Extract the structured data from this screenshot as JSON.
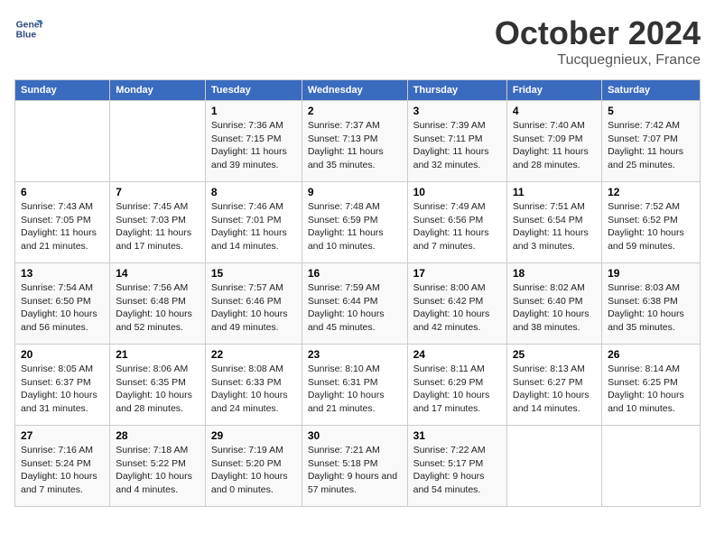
{
  "header": {
    "logo_line1": "General",
    "logo_line2": "Blue",
    "month_year": "October 2024",
    "location": "Tucquegnieux, France"
  },
  "days_of_week": [
    "Sunday",
    "Monday",
    "Tuesday",
    "Wednesday",
    "Thursday",
    "Friday",
    "Saturday"
  ],
  "weeks": [
    [
      {
        "day": "",
        "info": ""
      },
      {
        "day": "",
        "info": ""
      },
      {
        "day": "1",
        "info": "Sunrise: 7:36 AM\nSunset: 7:15 PM\nDaylight: 11 hours and 39 minutes."
      },
      {
        "day": "2",
        "info": "Sunrise: 7:37 AM\nSunset: 7:13 PM\nDaylight: 11 hours and 35 minutes."
      },
      {
        "day": "3",
        "info": "Sunrise: 7:39 AM\nSunset: 7:11 PM\nDaylight: 11 hours and 32 minutes."
      },
      {
        "day": "4",
        "info": "Sunrise: 7:40 AM\nSunset: 7:09 PM\nDaylight: 11 hours and 28 minutes."
      },
      {
        "day": "5",
        "info": "Sunrise: 7:42 AM\nSunset: 7:07 PM\nDaylight: 11 hours and 25 minutes."
      }
    ],
    [
      {
        "day": "6",
        "info": "Sunrise: 7:43 AM\nSunset: 7:05 PM\nDaylight: 11 hours and 21 minutes."
      },
      {
        "day": "7",
        "info": "Sunrise: 7:45 AM\nSunset: 7:03 PM\nDaylight: 11 hours and 17 minutes."
      },
      {
        "day": "8",
        "info": "Sunrise: 7:46 AM\nSunset: 7:01 PM\nDaylight: 11 hours and 14 minutes."
      },
      {
        "day": "9",
        "info": "Sunrise: 7:48 AM\nSunset: 6:59 PM\nDaylight: 11 hours and 10 minutes."
      },
      {
        "day": "10",
        "info": "Sunrise: 7:49 AM\nSunset: 6:56 PM\nDaylight: 11 hours and 7 minutes."
      },
      {
        "day": "11",
        "info": "Sunrise: 7:51 AM\nSunset: 6:54 PM\nDaylight: 11 hours and 3 minutes."
      },
      {
        "day": "12",
        "info": "Sunrise: 7:52 AM\nSunset: 6:52 PM\nDaylight: 10 hours and 59 minutes."
      }
    ],
    [
      {
        "day": "13",
        "info": "Sunrise: 7:54 AM\nSunset: 6:50 PM\nDaylight: 10 hours and 56 minutes."
      },
      {
        "day": "14",
        "info": "Sunrise: 7:56 AM\nSunset: 6:48 PM\nDaylight: 10 hours and 52 minutes."
      },
      {
        "day": "15",
        "info": "Sunrise: 7:57 AM\nSunset: 6:46 PM\nDaylight: 10 hours and 49 minutes."
      },
      {
        "day": "16",
        "info": "Sunrise: 7:59 AM\nSunset: 6:44 PM\nDaylight: 10 hours and 45 minutes."
      },
      {
        "day": "17",
        "info": "Sunrise: 8:00 AM\nSunset: 6:42 PM\nDaylight: 10 hours and 42 minutes."
      },
      {
        "day": "18",
        "info": "Sunrise: 8:02 AM\nSunset: 6:40 PM\nDaylight: 10 hours and 38 minutes."
      },
      {
        "day": "19",
        "info": "Sunrise: 8:03 AM\nSunset: 6:38 PM\nDaylight: 10 hours and 35 minutes."
      }
    ],
    [
      {
        "day": "20",
        "info": "Sunrise: 8:05 AM\nSunset: 6:37 PM\nDaylight: 10 hours and 31 minutes."
      },
      {
        "day": "21",
        "info": "Sunrise: 8:06 AM\nSunset: 6:35 PM\nDaylight: 10 hours and 28 minutes."
      },
      {
        "day": "22",
        "info": "Sunrise: 8:08 AM\nSunset: 6:33 PM\nDaylight: 10 hours and 24 minutes."
      },
      {
        "day": "23",
        "info": "Sunrise: 8:10 AM\nSunset: 6:31 PM\nDaylight: 10 hours and 21 minutes."
      },
      {
        "day": "24",
        "info": "Sunrise: 8:11 AM\nSunset: 6:29 PM\nDaylight: 10 hours and 17 minutes."
      },
      {
        "day": "25",
        "info": "Sunrise: 8:13 AM\nSunset: 6:27 PM\nDaylight: 10 hours and 14 minutes."
      },
      {
        "day": "26",
        "info": "Sunrise: 8:14 AM\nSunset: 6:25 PM\nDaylight: 10 hours and 10 minutes."
      }
    ],
    [
      {
        "day": "27",
        "info": "Sunrise: 7:16 AM\nSunset: 5:24 PM\nDaylight: 10 hours and 7 minutes."
      },
      {
        "day": "28",
        "info": "Sunrise: 7:18 AM\nSunset: 5:22 PM\nDaylight: 10 hours and 4 minutes."
      },
      {
        "day": "29",
        "info": "Sunrise: 7:19 AM\nSunset: 5:20 PM\nDaylight: 10 hours and 0 minutes."
      },
      {
        "day": "30",
        "info": "Sunrise: 7:21 AM\nSunset: 5:18 PM\nDaylight: 9 hours and 57 minutes."
      },
      {
        "day": "31",
        "info": "Sunrise: 7:22 AM\nSunset: 5:17 PM\nDaylight: 9 hours and 54 minutes."
      },
      {
        "day": "",
        "info": ""
      },
      {
        "day": "",
        "info": ""
      }
    ]
  ]
}
